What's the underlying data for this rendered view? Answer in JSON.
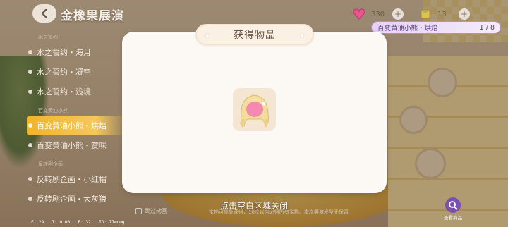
{
  "header": {
    "title": "金橡果展演",
    "resources": [
      {
        "name": "diamond",
        "icon": "pink-heart-gem-icon",
        "value": "330"
      },
      {
        "name": "ticket",
        "icon": "ticket-icon",
        "value": "13"
      }
    ],
    "collection": {
      "label": "百变黄油小熊・烘焙",
      "progress": "1 / 8"
    }
  },
  "sidebar": {
    "groups": [
      {
        "category": "水之誓约",
        "items": [
          "水之誓约・海月",
          "水之誓约・凝空",
          "水之誓约・浅境"
        ]
      },
      {
        "category": "百变黄油小熊",
        "items": [
          "百变黄油小熊・烘焙",
          "百变黄油小熊・赏味"
        ]
      },
      {
        "category": "反转剧企画",
        "items": [
          "反转剧企画・小红帽",
          "反转剧企画・大灰狼"
        ]
      }
    ],
    "active_item": "百变黄油小熊・烘焙"
  },
  "modal": {
    "title": "获得物品",
    "item_icon": "blonde-hair-item-icon",
    "close_hint": "点击空白区域关闭"
  },
  "footer": {
    "skip_label": "跳过动画",
    "note": "宝物可重复获得，10次以内必得所有宝物。本次展演发型无保留",
    "zoom_label": "查看商品",
    "debug": {
      "f": "F: 29",
      "t": "T: 0.00",
      "p": "P: 32",
      "id": "ID: 77mumg"
    }
  },
  "colors": {
    "accent": "#f0b42c",
    "modal_bg": "#fcf9f4",
    "pill_border": "#b58ad6"
  }
}
